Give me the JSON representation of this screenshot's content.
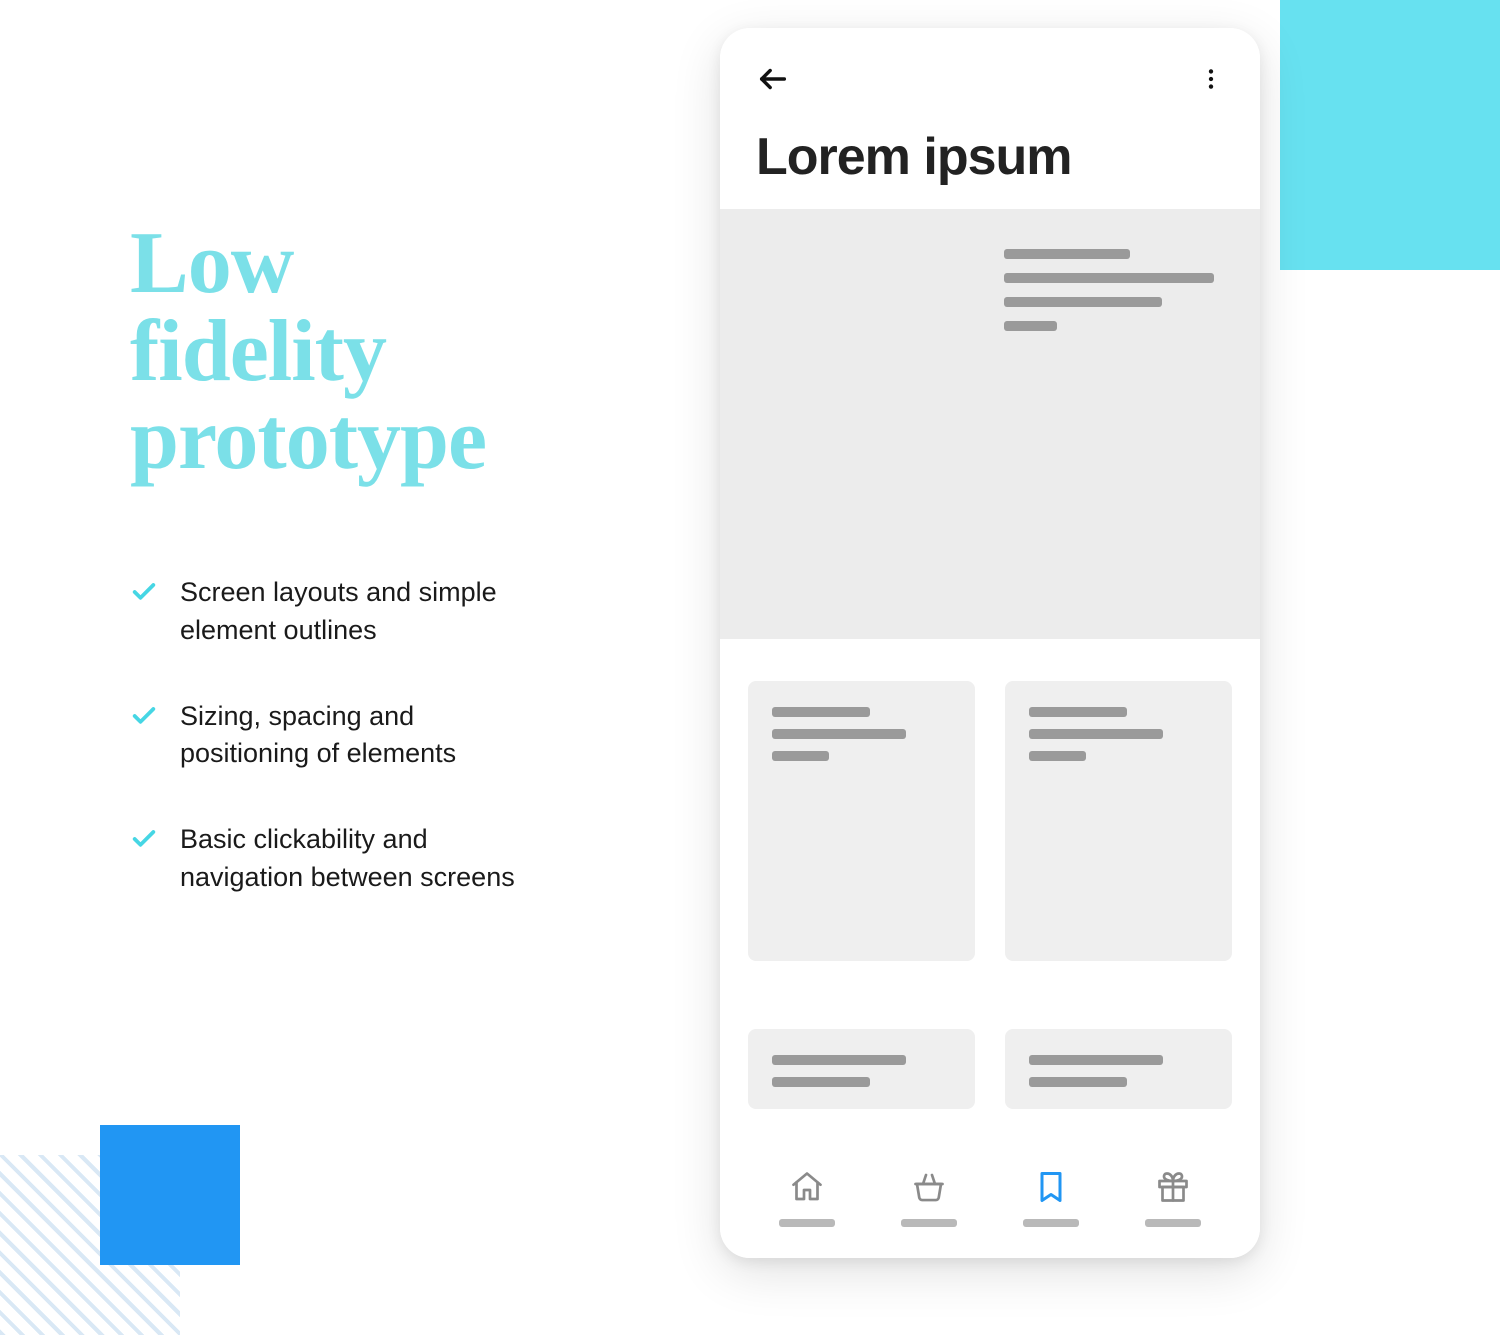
{
  "decor": {
    "accent_cyan": "#67E1F0",
    "accent_blue": "#2196F3"
  },
  "left": {
    "headline_line1": "Low",
    "headline_line2": "fidelity",
    "headline_line3": "prototype",
    "bullets": [
      "Screen layouts and simple element outlines",
      "Sizing, spacing and positioning of elements",
      "Basic clickability and navigation between screens"
    ]
  },
  "phone": {
    "title": "Lorem ipsum",
    "nav": {
      "items": [
        {
          "icon": "home-icon",
          "active": false
        },
        {
          "icon": "basket-icon",
          "active": false
        },
        {
          "icon": "bookmark-icon",
          "active": true
        },
        {
          "icon": "gift-icon",
          "active": false
        }
      ],
      "active_color": "#2196F3",
      "inactive_color": "#8a8a8a"
    }
  }
}
